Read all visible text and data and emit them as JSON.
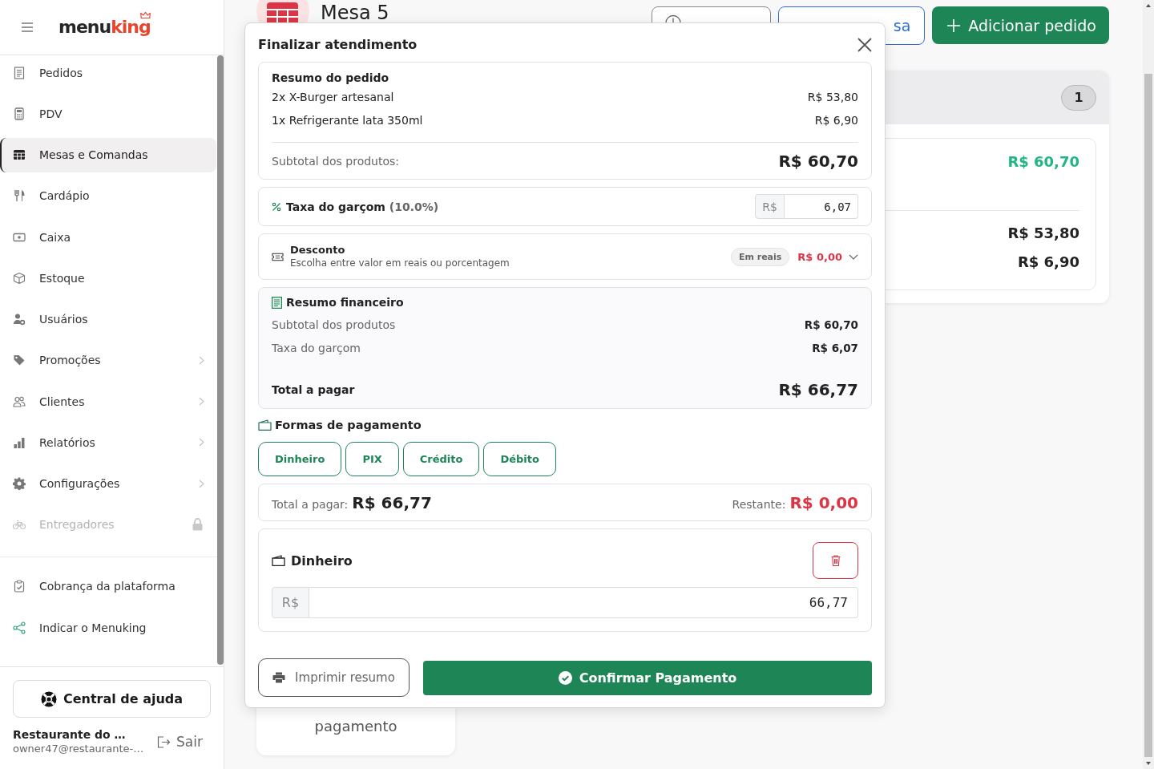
{
  "sidebar": {
    "logo": {
      "main": "menu",
      "accent": "king"
    },
    "nav_items": [
      {
        "label": "Pedidos",
        "selected": false,
        "has_submenu": false,
        "locked": false
      },
      {
        "label": "PDV",
        "selected": false,
        "has_submenu": false,
        "locked": false
      },
      {
        "label": "Mesas e Comandas",
        "selected": true,
        "has_submenu": false,
        "locked": false
      },
      {
        "label": "Cardápio",
        "selected": false,
        "has_submenu": false,
        "locked": false
      },
      {
        "label": "Caixa",
        "selected": false,
        "has_submenu": false,
        "locked": false
      },
      {
        "label": "Estoque",
        "selected": false,
        "has_submenu": false,
        "locked": false
      },
      {
        "label": "Usuários",
        "selected": false,
        "has_submenu": false,
        "locked": false
      },
      {
        "label": "Promoções",
        "selected": false,
        "has_submenu": true,
        "locked": false
      },
      {
        "label": "Clientes",
        "selected": false,
        "has_submenu": true,
        "locked": false
      },
      {
        "label": "Relatórios",
        "selected": false,
        "has_submenu": true,
        "locked": false
      },
      {
        "label": "Configurações",
        "selected": false,
        "has_submenu": true,
        "locked": false
      },
      {
        "label": "Entregadores",
        "selected": false,
        "has_submenu": false,
        "locked": true
      }
    ],
    "footer_items": [
      {
        "label": "Cobrança da plataforma",
        "selected": false
      },
      {
        "label": "Indicar o Menuking",
        "selected": false
      }
    ],
    "help_button": "Central de ajuda",
    "user": {
      "name": "Restaurante do …",
      "email": "owner47@restaurante-…"
    },
    "logout": "Sair"
  },
  "table_header": {
    "title": "Mesa 5",
    "buttons": [
      {
        "kind": "history"
      },
      {
        "kind": "switch",
        "label": "sa"
      },
      {
        "kind": "add",
        "label": "Adicionar pedido"
      }
    ]
  },
  "order_card": {
    "count": "1",
    "total": "R$ 60,70",
    "item_prices": [
      "R$ 53,80",
      "R$ 6,90"
    ]
  },
  "info_card": {
    "text": "pagamento"
  },
  "modal": {
    "title": "Finalizar atendimento",
    "order_summary": {
      "title": "Resumo do pedido",
      "items": [
        {
          "name": "2x X-Burger artesanal",
          "price": "R$ 53,80"
        },
        {
          "name": "1x Refrigerante lata 350ml",
          "price": "R$ 6,90"
        }
      ],
      "subtotal_label": "Subtotal dos produtos:",
      "subtotal": "R$ 60,70"
    },
    "service_fee": {
      "label": "Taxa do garçom",
      "rate": "(10.0%)",
      "currency": "R$",
      "value": "6,07"
    },
    "discount": {
      "title": "Desconto",
      "hint": "Escolha entre valor em reais ou porcentagem",
      "mode": "Em reais",
      "amount": "R$ 0,00",
      "expanded": false
    },
    "financial_summary": {
      "title": "Resumo financeiro",
      "rows": [
        {
          "label": "Subtotal dos produtos",
          "value": "R$ 60,70"
        },
        {
          "label": "Taxa do garçom",
          "value": "R$ 6,07"
        }
      ],
      "total_label": "Total a pagar",
      "total": "R$ 66,77"
    },
    "payment_methods": {
      "title": "Formas de pagamento",
      "options": [
        {
          "label": "Dinheiro",
          "selected": false
        },
        {
          "label": "PIX",
          "selected": false
        },
        {
          "label": "Crédito",
          "selected": false
        },
        {
          "label": "Débito",
          "selected": false
        }
      ]
    },
    "payment_status": {
      "total_label": "Total a pagar:",
      "total": "R$ 66,77",
      "remaining_label": "Restante:",
      "remaining": "R$ 0,00"
    },
    "payments": [
      {
        "method": "Dinheiro",
        "currency": "R$",
        "value": "66,77"
      }
    ],
    "print_button": "Imprimir resumo",
    "confirm_button": "Confirmar Pagamento"
  }
}
